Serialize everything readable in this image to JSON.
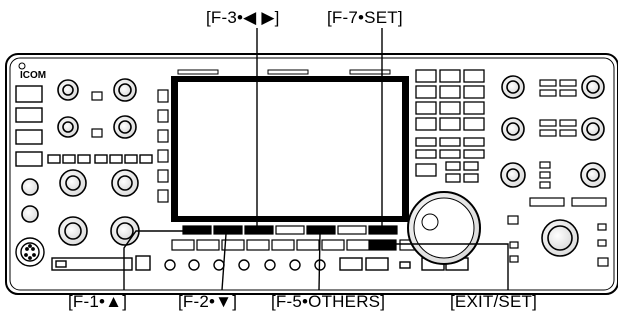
{
  "brand": "ICOM",
  "callouts": {
    "top": [
      "[F-3•◀ ▶]",
      "[F-7•SET]"
    ],
    "bottom": [
      "[F-1•▲]",
      "[F-2•▼]",
      "[F-5•OTHERS]",
      "[EXIT/SET]"
    ]
  }
}
